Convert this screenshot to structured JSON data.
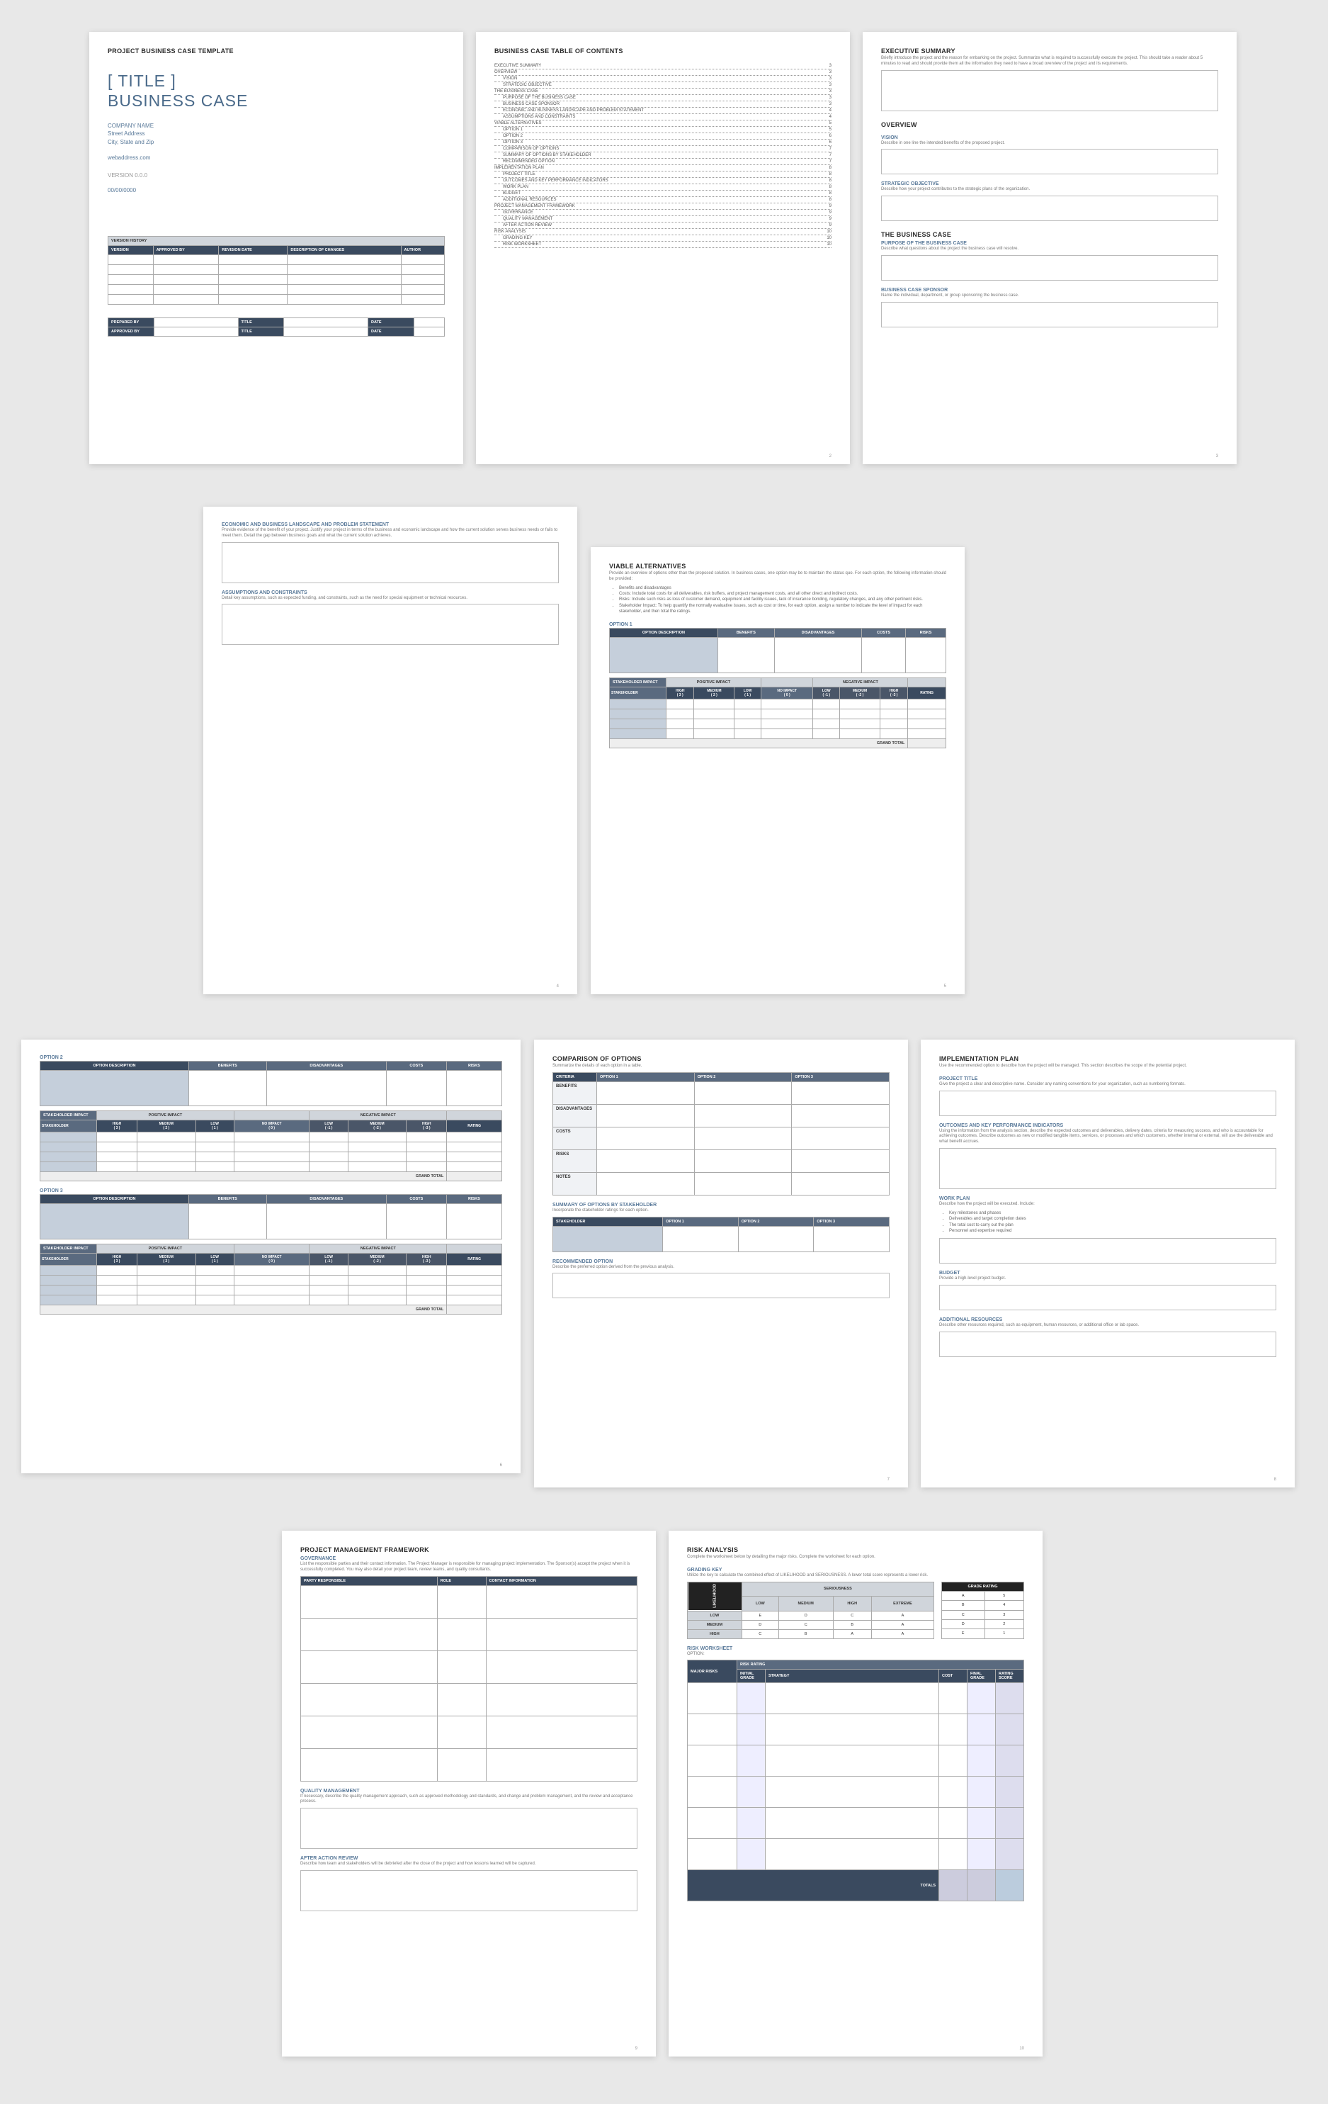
{
  "p1": {
    "header": "PROJECT BUSINESS CASE TEMPLATE",
    "title1": "[ TITLE ]",
    "title2": "BUSINESS CASE",
    "company": "COMPANY NAME",
    "addr1": "Street Address",
    "addr2": "City, State and Zip",
    "web": "webaddress.com",
    "version": "VERSION 0.0.0",
    "date": "00/00/0000",
    "vh_header": "VERSION HISTORY",
    "vh_cols": [
      "VERSION",
      "APPROVED BY",
      "REVISION DATE",
      "DESCRIPTION OF CHANGES",
      "AUTHOR"
    ],
    "prep": [
      [
        "PREPARED BY",
        "",
        "TITLE",
        "",
        "DATE",
        ""
      ],
      [
        "APPROVED BY",
        "",
        "TITLE",
        "",
        "DATE",
        ""
      ]
    ]
  },
  "p2": {
    "header": "BUSINESS CASE TABLE OF CONTENTS",
    "toc": [
      [
        "EXECUTIVE SUMMARY",
        "3",
        0
      ],
      [
        "OVERVIEW",
        "3",
        0
      ],
      [
        "VISION",
        "3",
        1
      ],
      [
        "STRATEGIC OBJECTIVE",
        "3",
        1
      ],
      [
        "THE BUSINESS CASE",
        "3",
        0
      ],
      [
        "PURPOSE OF THE BUSINESS CASE",
        "3",
        1
      ],
      [
        "BUSINESS CASE SPONSOR",
        "3",
        1
      ],
      [
        "ECONOMIC AND BUSINESS LANDSCAPE AND PROBLEM STATEMENT",
        "4",
        1
      ],
      [
        "ASSUMPTIONS AND CONSTRAINTS",
        "4",
        1
      ],
      [
        "VIABLE ALTERNATIVES",
        "5",
        0
      ],
      [
        "OPTION 1",
        "5",
        1
      ],
      [
        "OPTION 2",
        "6",
        1
      ],
      [
        "OPTION 3",
        "6",
        1
      ],
      [
        "COMPARISON OF OPTIONS",
        "7",
        1
      ],
      [
        "SUMMARY OF OPTIONS BY STAKEHOLDER",
        "7",
        1
      ],
      [
        "RECOMMENDED OPTION",
        "7",
        1
      ],
      [
        "IMPLEMENTATION PLAN",
        "8",
        0
      ],
      [
        "PROJECT TITLE",
        "8",
        1
      ],
      [
        "OUTCOMES AND KEY PERFORMANCE INDICATORS",
        "8",
        1
      ],
      [
        "WORK PLAN",
        "8",
        1
      ],
      [
        "BUDGET",
        "8",
        1
      ],
      [
        "ADDITIONAL RESOURCES",
        "8",
        1
      ],
      [
        "PROJECT MANAGEMENT FRAMEWORK",
        "9",
        0
      ],
      [
        "GOVERNANCE",
        "9",
        1
      ],
      [
        "QUALITY MANAGEMENT",
        "9",
        1
      ],
      [
        "AFTER ACTION REVIEW",
        "9",
        1
      ],
      [
        "RISK ANALYSIS",
        "10",
        0
      ],
      [
        "GRADING KEY",
        "10",
        1
      ],
      [
        "RISK WORKSHEET",
        "10",
        1
      ]
    ]
  },
  "p3": {
    "h1": "EXECUTIVE SUMMARY",
    "d1": "Briefly introduce the project and the reason for embarking on the project. Summarize what is required to successfully execute the project. This should take a reader about 5 minutes to read and should provide them all the information they need to have a broad overview of the project and its requirements.",
    "h2": "OVERVIEW",
    "s1": "VISION",
    "sd1": "Describe in one line the intended benefits of the proposed project.",
    "s2": "STRATEGIC OBJECTIVE",
    "sd2": "Describe how your project contributes to the strategic plans of the organization.",
    "h3": "THE BUSINESS CASE",
    "s3": "PURPOSE OF THE BUSINESS CASE",
    "sd3": "Describe what questions about the project the business case will resolve.",
    "s4": "BUSINESS CASE SPONSOR",
    "sd4": "Name the individual, department, or group sponsoring the business case."
  },
  "p4": {
    "s1": "ECONOMIC AND BUSINESS LANDSCAPE AND PROBLEM STATEMENT",
    "sd1": "Provide evidence of the benefit of your project. Justify your project in terms of the business and economic landscape and how the current solution serves business needs or fails to meet them. Detail the gap between business goals and what the current solution achieves.",
    "s2": "ASSUMPTIONS AND CONSTRAINTS",
    "sd2": "Detail key assumptions, such as expected funding, and constraints, such as the need for special equipment or technical resources."
  },
  "p5": {
    "h": "VIABLE ALTERNATIVES",
    "d": "Provide an overview of options other than the proposed solution. In business cases, one option may be to maintain the status quo. For each option, the following information should be provided:",
    "b": [
      "Benefits and disadvantages",
      "Costs: Include total costs for all deliverables, risk buffers, and project management costs, and all other direct and indirect costs.",
      "Risks: Include such risks as loss of customer demand, equipment and facility issues, lack of insurance bonding, regulatory changes, and any other pertinent risks.",
      "Stakeholder Impact: To help quantify the normally evaluative issues, such as cost or time, for each option, assign a number to indicate the level of impact for each stakeholder, and then total the ratings."
    ],
    "opt": "OPTION 1",
    "cols": [
      "OPTION DESCRIPTION",
      "BENEFITS",
      "DISADVANTAGES",
      "COSTS",
      "RISKS"
    ],
    "imp": "STAKEHOLDER IMPACT",
    "pos": "POSITIVE IMPACT",
    "neg": "NEGATIVE IMPACT",
    "stk": "STAKEHOLDER",
    "labels": [
      "HIGH ( 3 )",
      "MEDIUM ( 2 )",
      "LOW ( 1 )",
      "NO IMPACT ( 0 )",
      "LOW ( -1 )",
      "MEDIUM ( -2 )",
      "HIGH ( -3 )",
      "RATING"
    ],
    "gt": "GRAND TOTAL"
  },
  "p6": {
    "o2": "OPTION 2",
    "o3": "OPTION 3"
  },
  "p7": {
    "h1": "COMPARISON OF OPTIONS",
    "d1": "Summarize the details of each option in a table.",
    "cols": [
      "CRITERIA",
      "OPTION 1",
      "OPTION 2",
      "OPTION 3"
    ],
    "rows": [
      "BENEFITS",
      "DISADVANTAGES",
      "COSTS",
      "RISKS",
      "NOTES"
    ],
    "h2": "SUMMARY OF OPTIONS BY STAKEHOLDER",
    "d2": "Incorporate the stakeholder ratings for each option.",
    "scols": [
      "STAKEHOLDER",
      "OPTION 1",
      "OPTION 2",
      "OPTION 3"
    ],
    "h3": "RECOMMENDED OPTION",
    "d3": "Describe the preferred option derived from the previous analysis."
  },
  "p8": {
    "h": "IMPLEMENTATION PLAN",
    "d": "Use the recommended option to describe how the project will be managed. This section describes the scope of the potential project.",
    "s1": "PROJECT TITLE",
    "sd1": "Give the project a clear and descriptive name. Consider any naming conventions for your organization, such as numbering formats.",
    "s2": "OUTCOMES AND KEY PERFORMANCE INDICATORS",
    "sd2": "Using the information from the analysis section, describe the expected outcomes and deliverables, delivery dates, criteria for measuring success, and who is accountable for achieving outcomes. Describe outcomes as new or modified tangible items, services, or processes and which customers, whether internal or external, will use the deliverable and what benefit accrues.",
    "s3": "WORK PLAN",
    "sd3": "Describe how the project will be executed. Include:",
    "b": [
      "Key milestones and phases",
      "Deliverables and target completion dates",
      "The total cost to carry out the plan",
      "Personnel and expertise required"
    ],
    "s4": "BUDGET",
    "sd4": "Provide a high-level project budget.",
    "s5": "ADDITIONAL RESOURCES",
    "sd5": "Describe other resources required, such as equipment, human resources, or additional office or lab space."
  },
  "p9": {
    "h": "PROJECT MANAGEMENT FRAMEWORK",
    "s1": "GOVERNANCE",
    "sd1": "List the responsible parties and their contact information. The Project Manager is responsible for managing project implementation. The Sponsor(s) accept the project when it is successfully completed. You may also detail your project team, review teams, and quality consultants.",
    "cols": [
      "PARTY RESPONSIBLE",
      "ROLE",
      "CONTACT INFORMATION"
    ],
    "s2": "QUALITY MANAGEMENT",
    "sd2": "If necessary, describe the quality management approach, such as approved methodology and standards, and change and problem management, and the review and acceptance process.",
    "s3": "AFTER ACTION REVIEW",
    "sd3": "Describe how team and stakeholders will be debriefed after the close of the project and how lessons learned will be captured."
  },
  "p10": {
    "h": "RISK ANALYSIS",
    "d": "Complete the worksheet below by detailing the major risks. Complete the worksheet for each option.",
    "s1": "GRADING KEY",
    "sd1": "Utilize the key to calculate the combined effect of LIKELIHOOD and SERIOUSNESS. A lower total score represents a lower risk.",
    "ser": "SERIOUSNESS",
    "lk": "LIKELIHOOD",
    "gr": "GRADE   RATING",
    "glabels": [
      "LOW",
      "MEDIUM",
      "HIGH",
      "EXTREME"
    ],
    "rows": [
      [
        "LOW",
        "E",
        "D",
        "C",
        "A"
      ],
      [
        "MEDIUM",
        "D",
        "C",
        "B",
        "A"
      ],
      [
        "HIGH",
        "C",
        "B",
        "A",
        "A"
      ]
    ],
    "rating": [
      [
        "A",
        "5"
      ],
      [
        "B",
        "4"
      ],
      [
        "C",
        "3"
      ],
      [
        "D",
        "2"
      ],
      [
        "E",
        "1"
      ]
    ],
    "s2": "RISK WORKSHEET",
    "opt": "OPTION:",
    "rcols": [
      "MAJOR RISKS",
      "INITIAL GRADE",
      "STRATEGY",
      "COST",
      "FINAL GRADE",
      "RATING SCORE"
    ],
    "rr": "RISK RATING",
    "tot": "TOTALS"
  }
}
